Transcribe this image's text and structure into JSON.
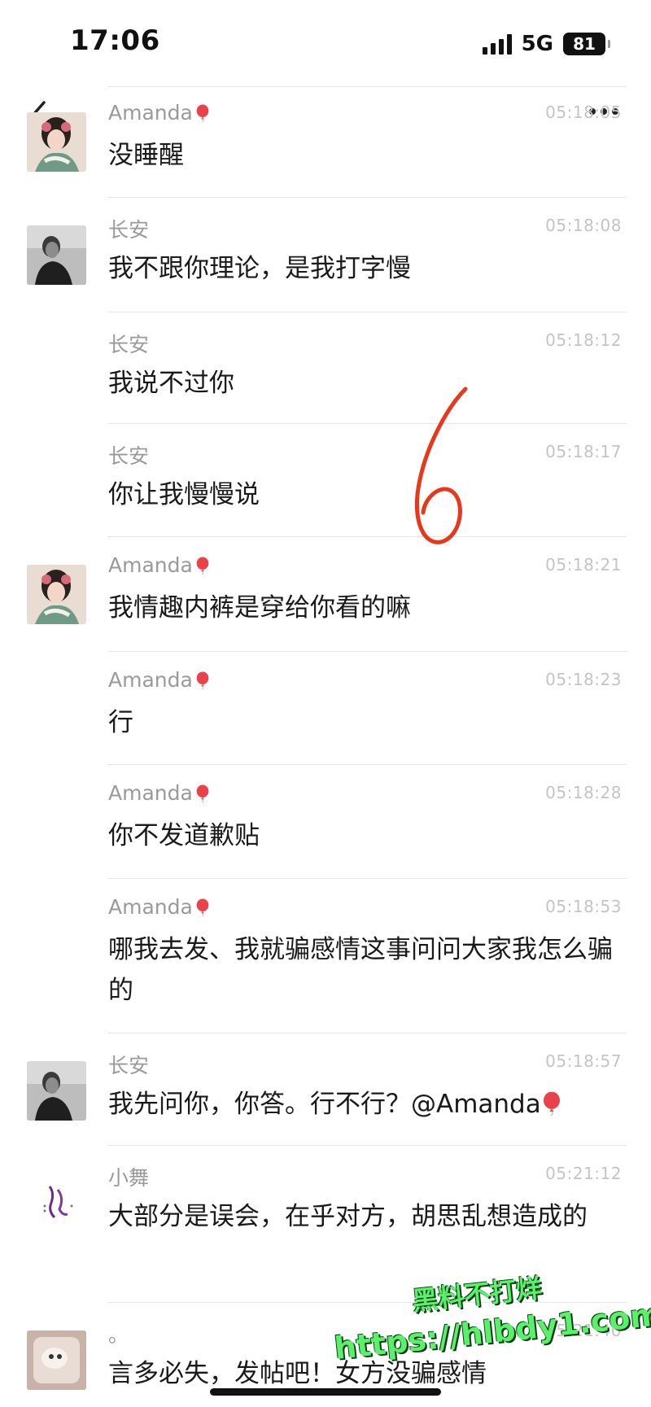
{
  "status": {
    "time": "17:06",
    "network": "5G",
    "battery": "81"
  },
  "messages": [
    {
      "sender": "Amanda",
      "balloon": true,
      "time": "05:18:05",
      "text": "没睡醒",
      "avatar": "avatar-amanda"
    },
    {
      "sender": "长安",
      "balloon": false,
      "time": "05:18:08",
      "text": "我不跟你理论，是我打字慢",
      "avatar": "avatar-changan"
    },
    {
      "sender": "长安",
      "balloon": false,
      "time": "05:18:12",
      "text": "我说不过你",
      "avatar": null
    },
    {
      "sender": "长安",
      "balloon": false,
      "time": "05:18:17",
      "text": "你让我慢慢说",
      "avatar": null
    },
    {
      "sender": "Amanda",
      "balloon": true,
      "time": "05:18:21",
      "text": "我情趣内裤是穿给你看的嘛",
      "avatar": "avatar-amanda"
    },
    {
      "sender": "Amanda",
      "balloon": true,
      "time": "05:18:23",
      "text": "行",
      "avatar": null
    },
    {
      "sender": "Amanda",
      "balloon": true,
      "time": "05:18:28",
      "text": "你不发道歉贴",
      "avatar": null
    },
    {
      "sender": "Amanda",
      "balloon": true,
      "time": "05:18:53",
      "text": "哪我去发、我就骗感情这事问问大家我怎么骗的",
      "avatar": null
    },
    {
      "sender": "长安",
      "balloon": false,
      "time": "05:18:57",
      "text": "我先问你，你答。行不行？@Amanda",
      "avatar": "avatar-changan"
    },
    {
      "sender": "小舞",
      "balloon": false,
      "time": "05:21:12",
      "text": "大部分是误会，在乎对方，胡思乱想造成的",
      "avatar": "avatar-xiaowu"
    },
    {
      "sender": "。",
      "balloon": false,
      "time": "05:21:40",
      "text": "言多必失，发帖吧！女方没骗感情",
      "avatar": "avatar-dot"
    }
  ],
  "watermark": {
    "line1": "黑料不打烊",
    "line2": "https://hlbdy1.com"
  },
  "icons": {
    "back": "chevron-left-icon",
    "more": "more-dots-icon",
    "balloon": "balloon-icon"
  },
  "colors": {
    "annotation": "#e8381c",
    "watermark": "#5af06a",
    "timestamp": "#c4c4c4"
  }
}
